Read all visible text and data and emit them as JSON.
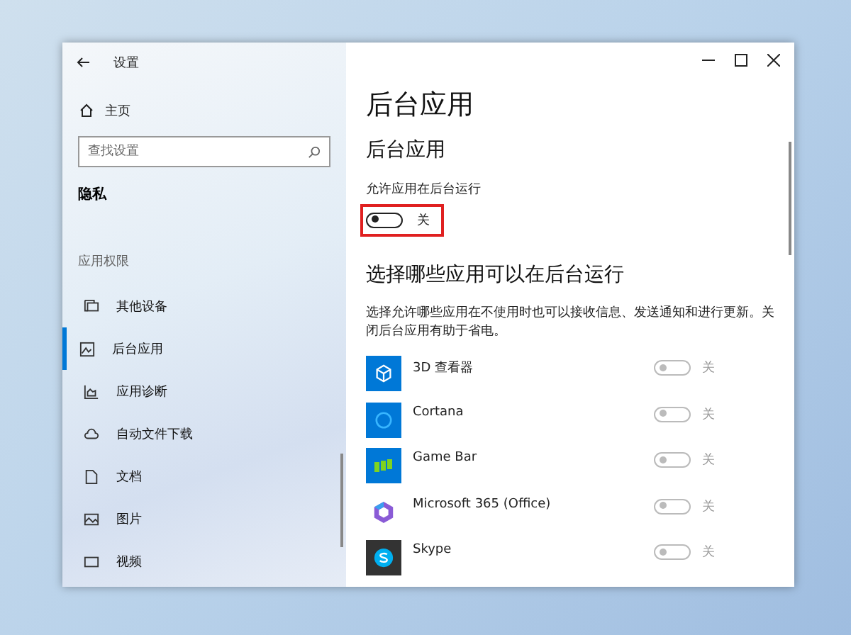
{
  "window": {
    "title": "设置"
  },
  "sidebar": {
    "home": "主页",
    "search": {
      "placeholder": "查找设置"
    },
    "section": "隐私",
    "group": "应用权限",
    "items": [
      {
        "label": "其他设备",
        "kind": "devices",
        "selected": false
      },
      {
        "label": "后台应用",
        "kind": "background",
        "selected": true
      },
      {
        "label": "应用诊断",
        "kind": "diagnostics",
        "selected": false
      },
      {
        "label": "自动文件下载",
        "kind": "cloud",
        "selected": false
      },
      {
        "label": "文档",
        "kind": "document",
        "selected": false
      },
      {
        "label": "图片",
        "kind": "picture",
        "selected": false
      },
      {
        "label": "视频",
        "kind": "video",
        "selected": false
      }
    ]
  },
  "content": {
    "title": "后台应用",
    "subtitle": "后台应用",
    "master": {
      "label": "允许应用在后台运行",
      "on": false,
      "state_text": "关"
    },
    "heading": "选择哪些应用可以在后台运行",
    "description": "选择允许哪些应用在不使用时也可以接收信息、发送通知和进行更新。关闭后台应用有助于省电。",
    "apps": [
      {
        "name": "3D 查看器",
        "kind": "cube",
        "on": false,
        "disabled": true,
        "state_text": "关"
      },
      {
        "name": "Cortana",
        "kind": "ring",
        "on": false,
        "disabled": true,
        "state_text": "关"
      },
      {
        "name": "Game Bar",
        "kind": "gamebar",
        "on": false,
        "disabled": true,
        "state_text": "关"
      },
      {
        "name": "Microsoft 365 (Office)",
        "kind": "office",
        "on": false,
        "disabled": true,
        "state_text": "关"
      },
      {
        "name": "Skype",
        "kind": "skype",
        "on": false,
        "disabled": true,
        "state_text": "关"
      }
    ]
  }
}
